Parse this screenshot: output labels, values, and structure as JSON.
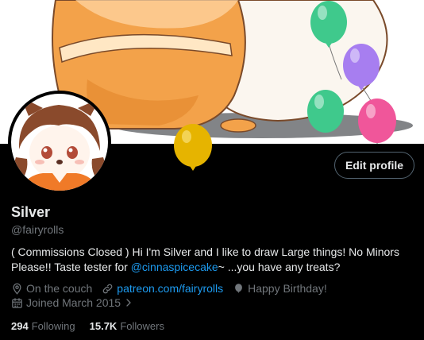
{
  "profile": {
    "name": "Silver",
    "handle": "@fairyrolls",
    "edit_label": "Edit profile",
    "bio": {
      "text_1": "( Commissions Closed ) Hi I'm Silver and I like to draw Large things! No Minors Please!! Taste tester for ",
      "mention": "@cinnaspicecake",
      "text_2": "~ ...you have any treats?"
    },
    "location": "On the couch",
    "website": "patreon.com/fairyrolls",
    "birthday": "Happy Birthday!",
    "joined": "Joined March 2015",
    "following_count": "294",
    "following_label": "Following",
    "followers_count": "15.7K",
    "followers_label": "Followers"
  },
  "icons": {
    "location": "location-pin-icon",
    "website": "link-icon",
    "birthday": "balloon-icon",
    "joined": "calendar-icon",
    "chevron": "chevron-right-icon"
  },
  "colors": {
    "background": "#000000",
    "text_primary": "#e7e9ea",
    "text_secondary": "#71767b",
    "accent_link": "#1d9bf0",
    "button_border": "#536471",
    "balloons": [
      "#3fc98c",
      "#a77ef0",
      "#f0569a",
      "#e6b400"
    ]
  }
}
